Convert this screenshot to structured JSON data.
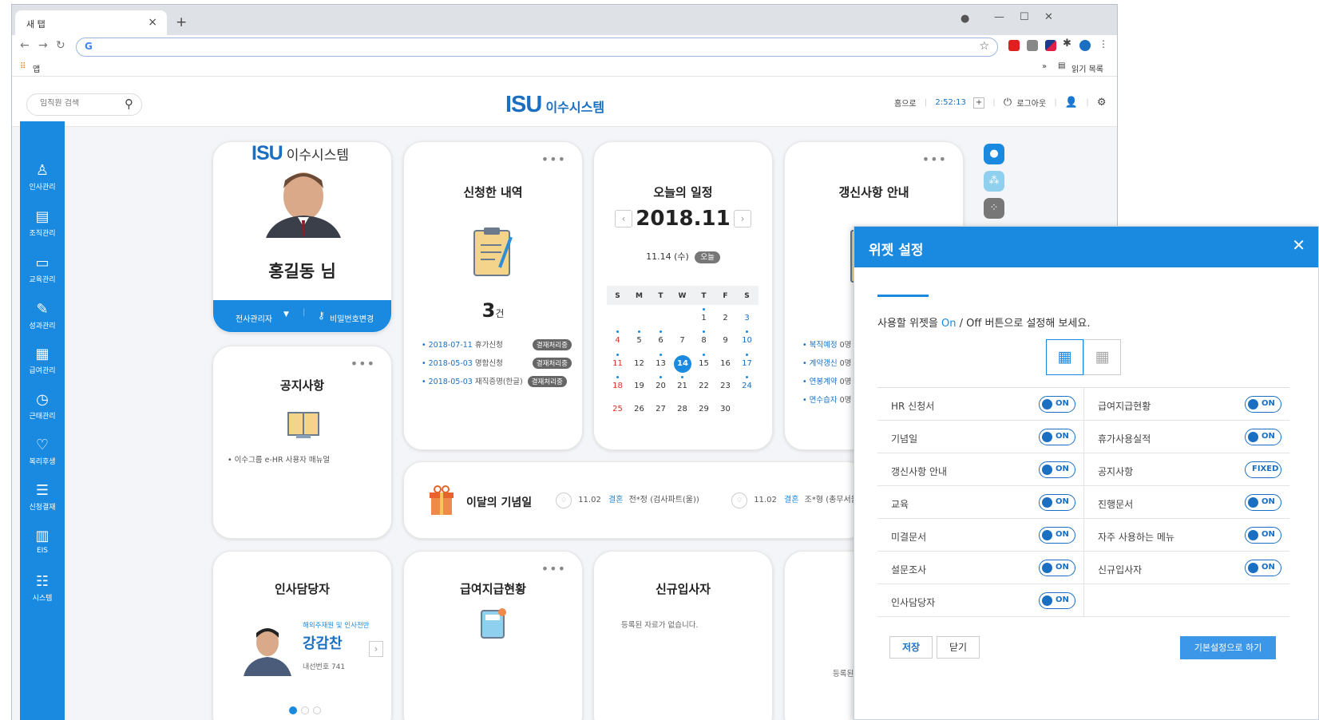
{
  "browser": {
    "tab_title": "새 탭",
    "tab_close": "×",
    "new_tab": "+",
    "bookmark_apps": "앱",
    "reading_list": "읽기 목록",
    "bookmark_more": "»"
  },
  "header": {
    "search_placeholder": "임직원 검색",
    "logo_mark": "ISU",
    "logo_text": "이수시스템",
    "home_link": "홈으로",
    "session_time": "2:52:13",
    "session_extend": "+",
    "logout": "로그아웃"
  },
  "sidebar": {
    "items": [
      {
        "label": "인사관리",
        "icon": "person-icon"
      },
      {
        "label": "조직관리",
        "icon": "building-icon"
      },
      {
        "label": "교육관리",
        "icon": "laptop-icon"
      },
      {
        "label": "성과관리",
        "icon": "edit-icon"
      },
      {
        "label": "급여관리",
        "icon": "calculator-icon"
      },
      {
        "label": "근태관리",
        "icon": "clock-icon"
      },
      {
        "label": "복리후생",
        "icon": "heart-icon"
      },
      {
        "label": "신청결재",
        "icon": "list-icon"
      },
      {
        "label": "EIS",
        "icon": "barchart-icon"
      },
      {
        "label": "시스템",
        "icon": "sliders-icon"
      }
    ]
  },
  "profile": {
    "logo_mark": "ISU",
    "logo_text": "이수시스템",
    "name": "홍길동 님",
    "role": "전사관리자",
    "password_change": "비밀번호변경"
  },
  "applications": {
    "title": "신청한 내역",
    "count": "3",
    "count_unit": "건",
    "items": [
      {
        "date": "2018-07-11",
        "name": "휴가신청",
        "status": "결재처리중"
      },
      {
        "date": "2018-05-03",
        "name": "명함신청",
        "status": "결재처리중"
      },
      {
        "date": "2018-05-03",
        "name": "재직증명(한글)",
        "status": "결재처리중"
      }
    ]
  },
  "schedule": {
    "title": "오늘의 일정",
    "month": "2018.11",
    "today_date": "11.14 (수)",
    "today_badge": "오늘",
    "weekdays": [
      "S",
      "M",
      "T",
      "W",
      "T",
      "F",
      "S"
    ],
    "weeks": [
      [
        "",
        "",
        "",
        "",
        "1",
        "2",
        "3"
      ],
      [
        "4",
        "5",
        "6",
        "7",
        "8",
        "9",
        "10"
      ],
      [
        "11",
        "12",
        "13",
        "14",
        "15",
        "16",
        "17"
      ],
      [
        "18",
        "19",
        "20",
        "21",
        "22",
        "23",
        "24"
      ],
      [
        "25",
        "26",
        "27",
        "28",
        "29",
        "30",
        ""
      ]
    ]
  },
  "renewal": {
    "title": "갱신사항 안내",
    "items": [
      {
        "name": "복직예정",
        "count": "0명"
      },
      {
        "name": "계약갱신",
        "count": "0명"
      },
      {
        "name": "연봉계약",
        "count": "0명"
      },
      {
        "name": "면수습자",
        "count": "0명"
      }
    ]
  },
  "notice": {
    "title": "공지사항",
    "item": "이수그룹 e-HR 사용자 매뉴얼"
  },
  "anniversary": {
    "title": "이달의 기념일",
    "items": [
      {
        "date": "11.02",
        "type": "결혼",
        "name": "전*정 (검사파트(울))"
      },
      {
        "date": "11.02",
        "type": "결혼",
        "name": "조*형 (총무서울)"
      }
    ]
  },
  "hr_manager": {
    "title": "인사담당자",
    "duty": "해외주재원 및 인사전반",
    "name": "강감찬",
    "extension": "내선번호 741"
  },
  "payment": {
    "title": "급여지급현황"
  },
  "new_hires": {
    "title": "신규입사자",
    "empty": "등록된 자료가 없습니다."
  },
  "partial_card": {
    "empty": "등록된"
  },
  "dialog": {
    "title": "위젯 설정",
    "instruction_pre": "사용할 위젯을 ",
    "instruction_on": "On",
    "instruction_post": " / Off 버튼으로 설정해 보세요.",
    "widgets": [
      [
        {
          "name": "HR 신청서",
          "state": "ON"
        },
        {
          "name": "급여지급현황",
          "state": "ON"
        }
      ],
      [
        {
          "name": "기념일",
          "state": "ON"
        },
        {
          "name": "휴가사용실적",
          "state": "ON"
        }
      ],
      [
        {
          "name": "갱신사항 안내",
          "state": "ON"
        },
        {
          "name": "공지사항",
          "state": "FIXED"
        }
      ],
      [
        {
          "name": "교육",
          "state": "ON"
        },
        {
          "name": "진행문서",
          "state": "ON"
        }
      ],
      [
        {
          "name": "미결문서",
          "state": "ON"
        },
        {
          "name": "자주 사용하는 메뉴",
          "state": "ON"
        }
      ],
      [
        {
          "name": "설문조사",
          "state": "ON"
        },
        {
          "name": "신규입사자",
          "state": "ON"
        }
      ],
      [
        {
          "name": "인사담당자",
          "state": "ON"
        },
        null
      ]
    ],
    "save": "저장",
    "close": "닫기",
    "reset_default": "기본설정으로 하기"
  }
}
